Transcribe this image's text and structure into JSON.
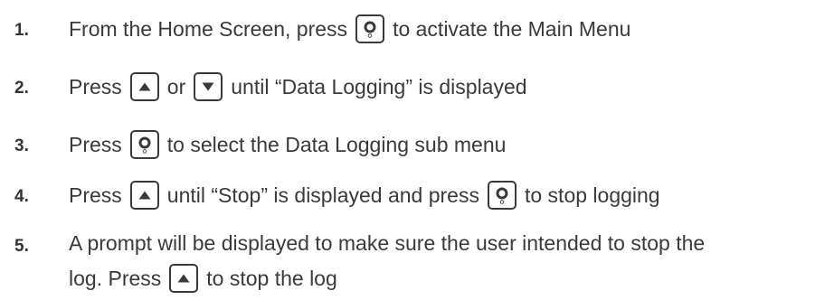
{
  "steps": [
    {
      "number": "1.",
      "parts": [
        {
          "type": "text",
          "value": "From the Home Screen, press"
        },
        {
          "type": "key",
          "icon": "select-icon"
        },
        {
          "type": "text",
          "value": "to activate the Main Menu"
        }
      ]
    },
    {
      "number": "2.",
      "parts": [
        {
          "type": "text",
          "value": "Press"
        },
        {
          "type": "key",
          "icon": "up-arrow-icon"
        },
        {
          "type": "text",
          "value": "or"
        },
        {
          "type": "key",
          "icon": "down-arrow-icon"
        },
        {
          "type": "text",
          "value": "until “Data Logging” is displayed"
        }
      ]
    },
    {
      "number": "3.",
      "parts": [
        {
          "type": "text",
          "value": "Press"
        },
        {
          "type": "key",
          "icon": "select-icon"
        },
        {
          "type": "text",
          "value": "to select the Data Logging sub menu"
        }
      ]
    },
    {
      "number": "4.",
      "parts": [
        {
          "type": "text",
          "value": "Press"
        },
        {
          "type": "key",
          "icon": "up-arrow-icon"
        },
        {
          "type": "text",
          "value": "until “Stop” is displayed and press"
        },
        {
          "type": "key",
          "icon": "select-icon"
        },
        {
          "type": "text",
          "value": "to stop logging"
        }
      ]
    },
    {
      "number": "5.",
      "line1": "A prompt will be displayed to make sure the user intended to stop the",
      "parts": [
        {
          "type": "text",
          "value": "log. Press"
        },
        {
          "type": "key",
          "icon": "up-arrow-icon"
        },
        {
          "type": "text",
          "value": "to stop the log"
        }
      ]
    }
  ]
}
